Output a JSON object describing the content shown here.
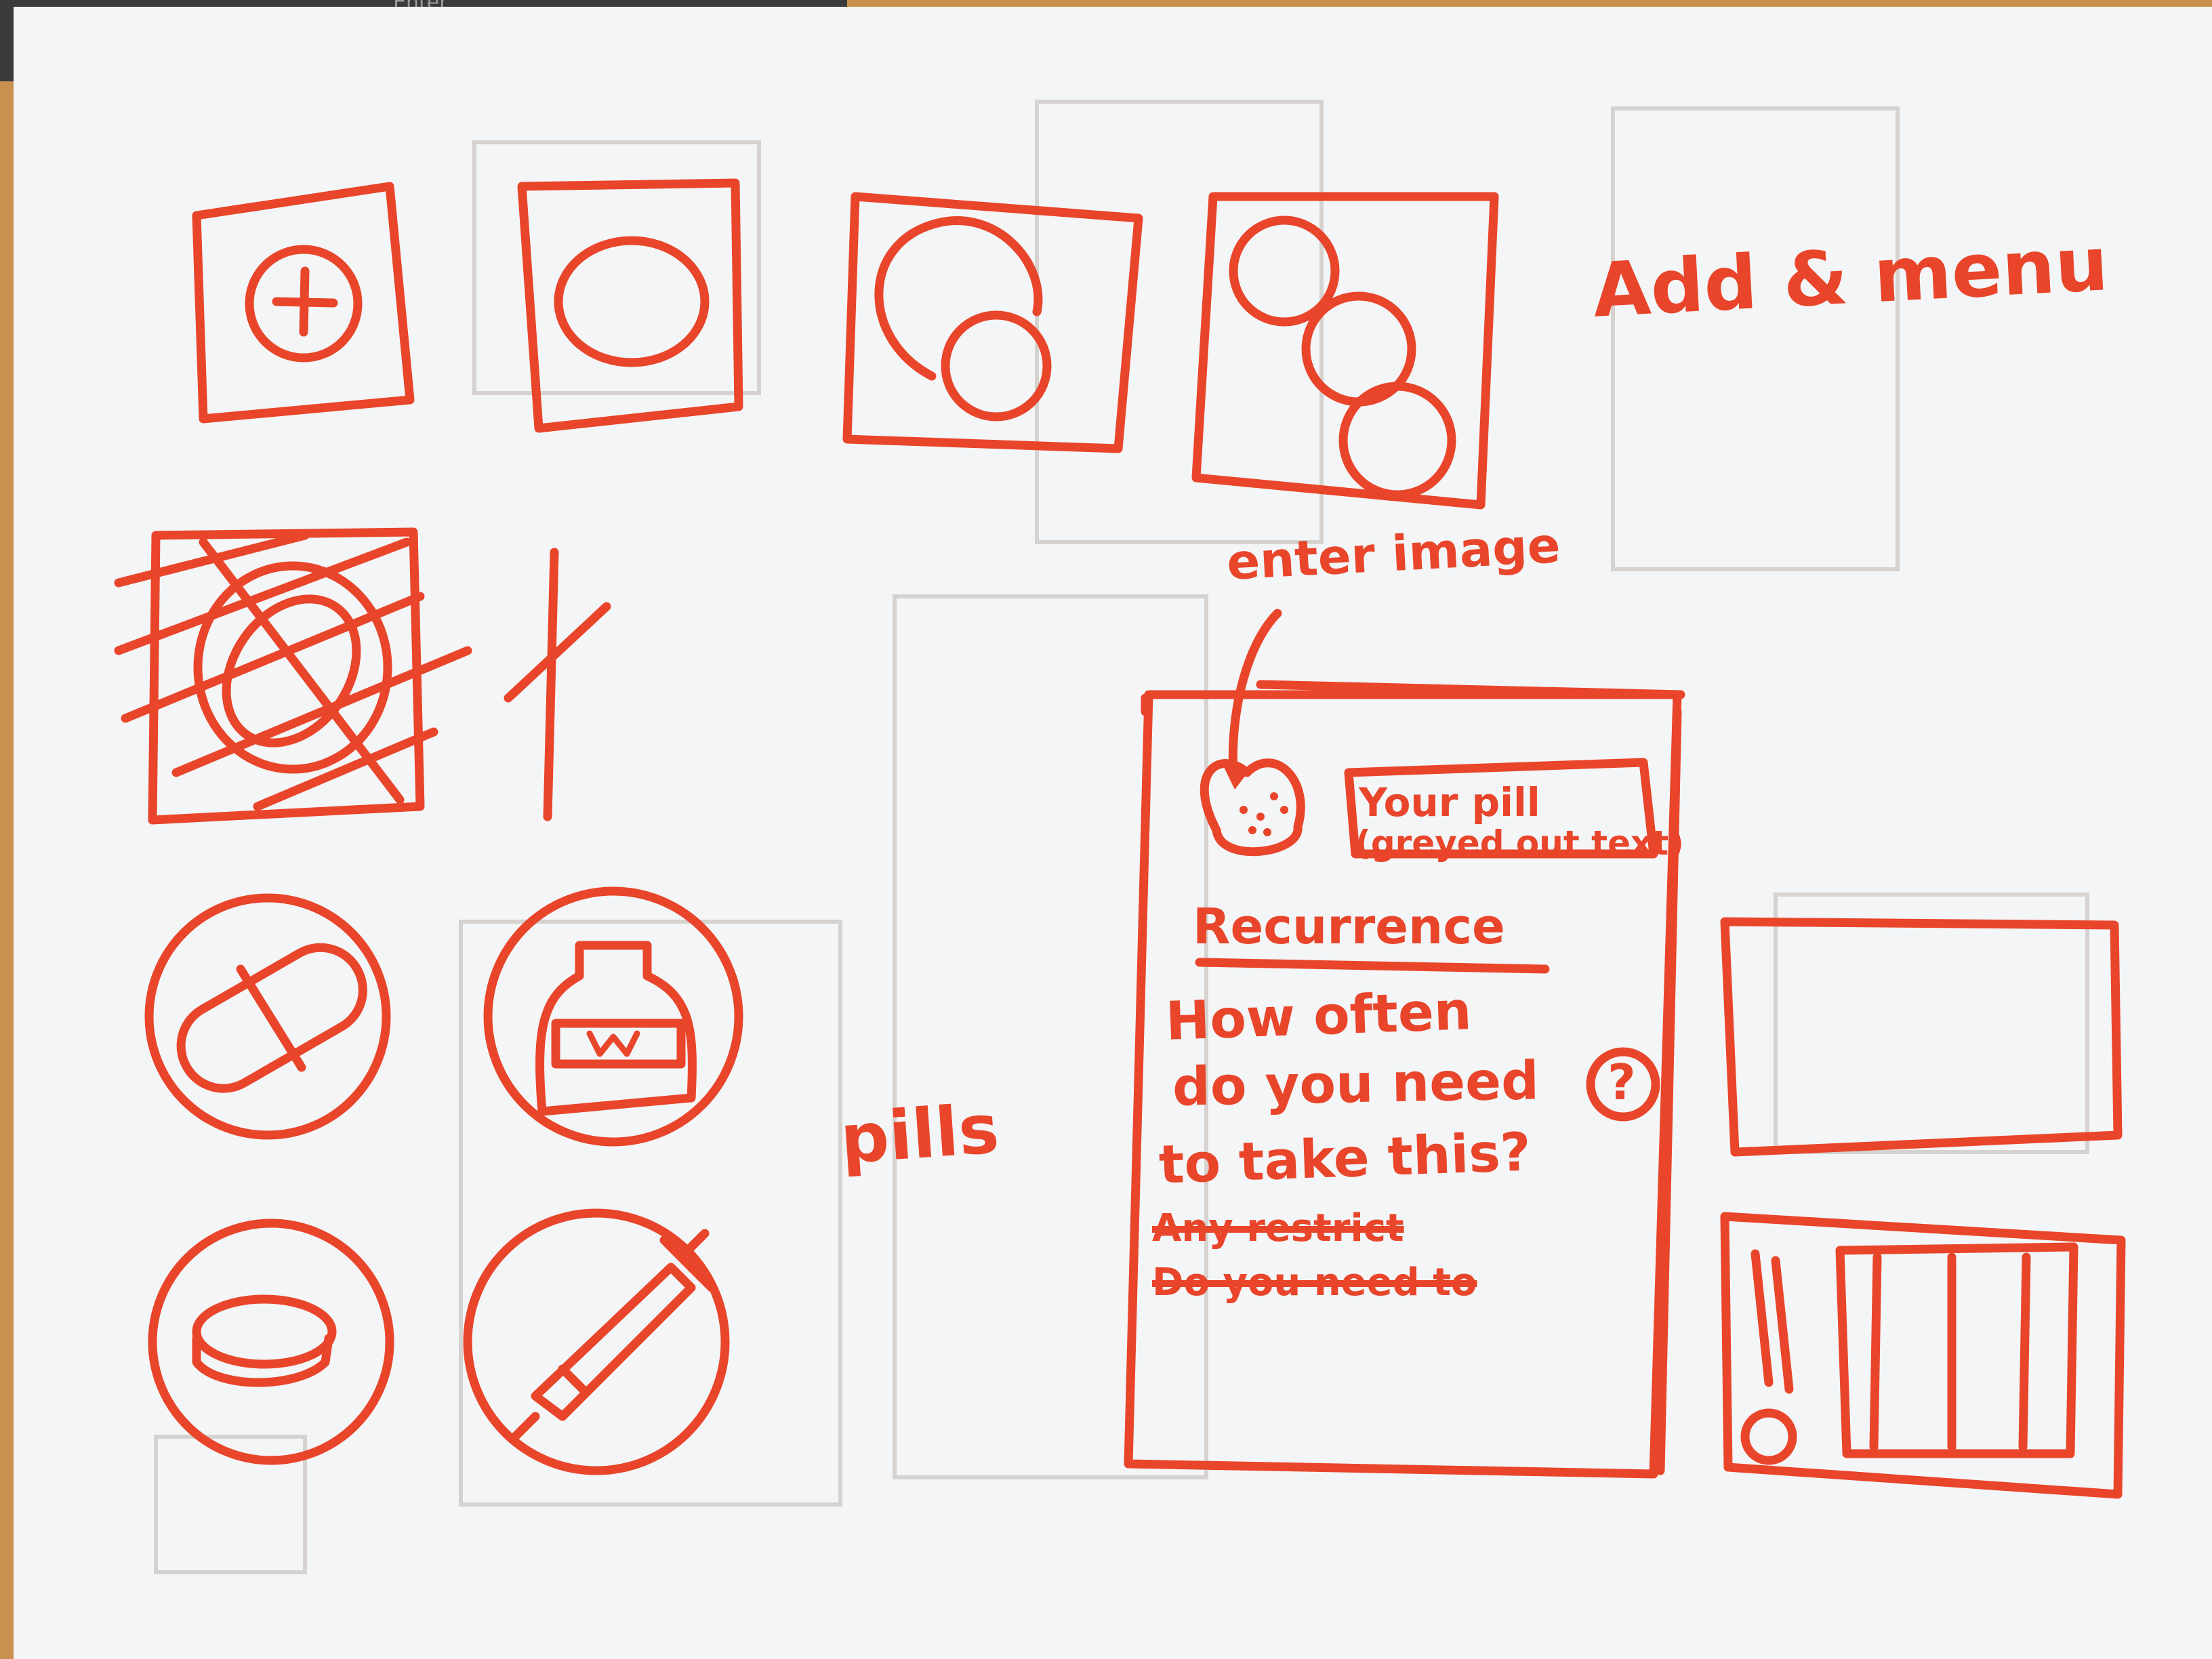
{
  "background_text": {
    "keyboard_key": "Enter"
  },
  "sections": {
    "add_menu_title": "Add & menu",
    "pills_title": "pills"
  },
  "detail_screen": {
    "annotation": "enter image",
    "name_field_line1": "Your pill",
    "name_field_line2": "(greyed out text)",
    "recurrence_heading": "Recurrence",
    "question_line1": "How often",
    "question_line2": "do you need",
    "question_line3": "to take this?",
    "help_symbol": "?",
    "struck_line1": "Any restrict",
    "struck_line2": "Do you need to"
  },
  "icons": [
    "plus-circle-icon",
    "single-circle-icon",
    "two-circles-icon",
    "three-circles-icon",
    "crossed-out-pill-icon",
    "capsule-icon",
    "bottle-icon",
    "tablet-icon",
    "syringe-icon"
  ],
  "colors": {
    "marker": "#e8452a",
    "paper": "#f4f5f7",
    "table": "#c8924e"
  }
}
